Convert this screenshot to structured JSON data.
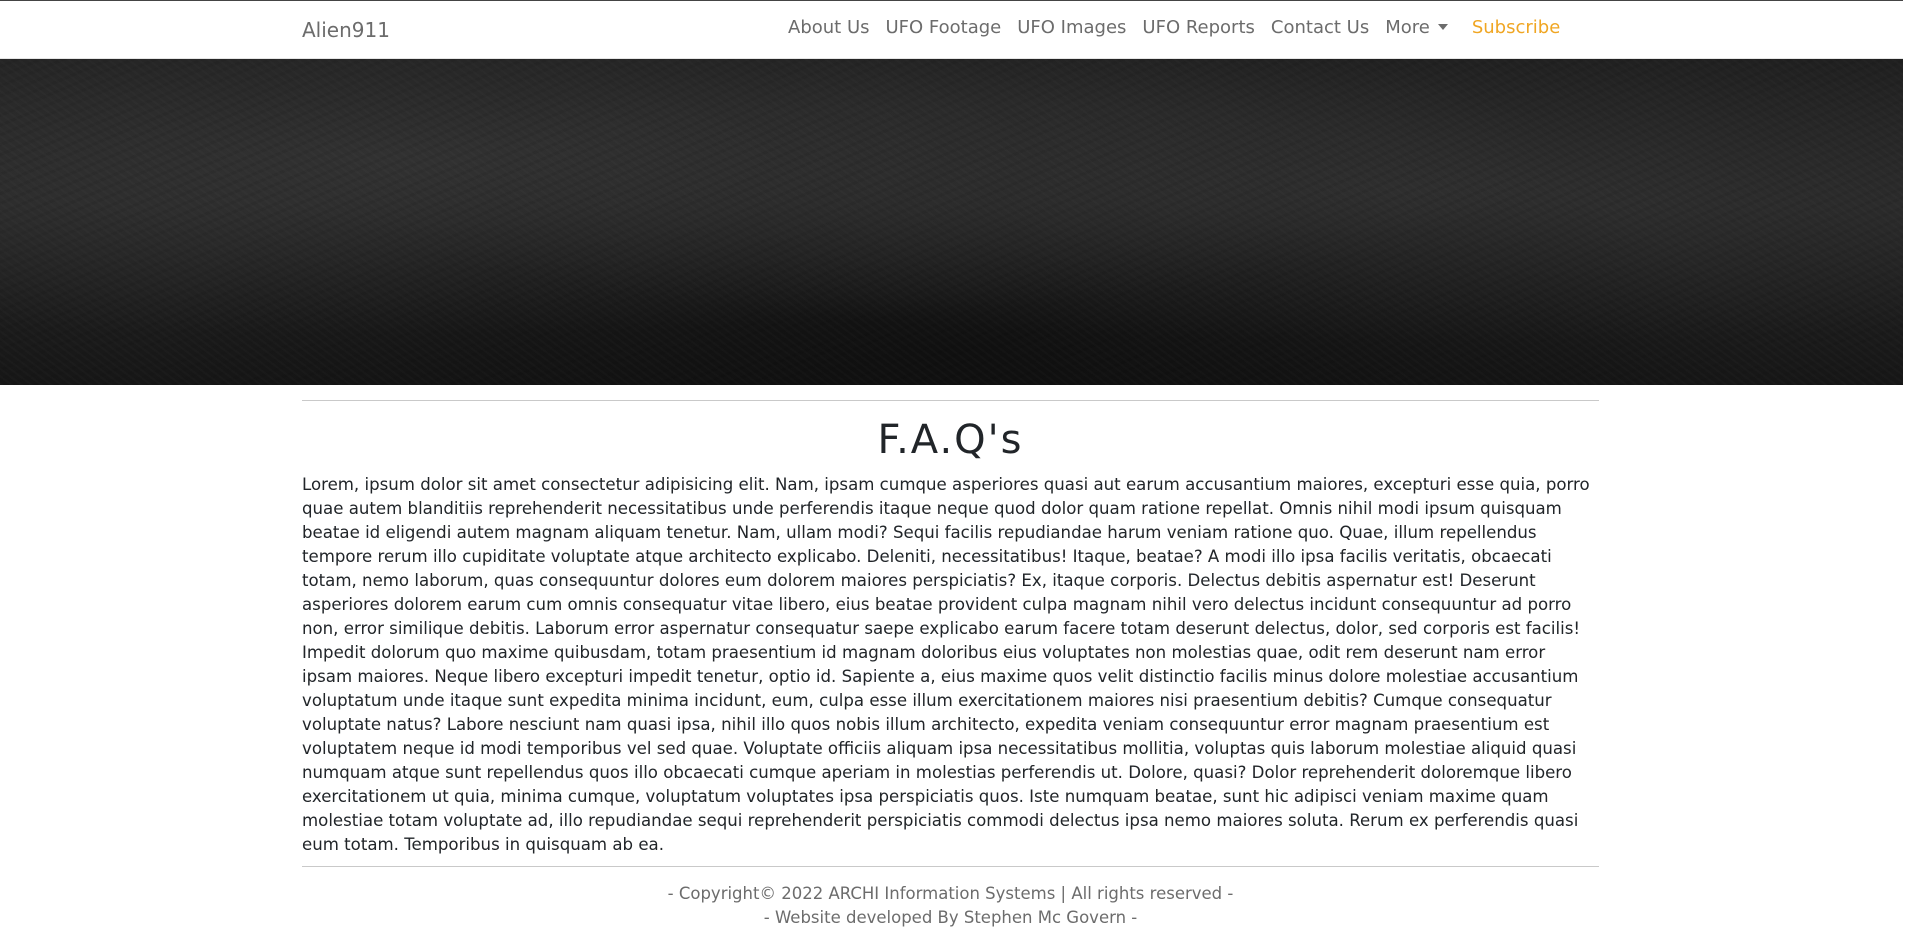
{
  "navbar": {
    "brand": "Alien911",
    "links": [
      {
        "label": "About Us"
      },
      {
        "label": "UFO Footage"
      },
      {
        "label": "UFO Images"
      },
      {
        "label": "UFO Reports"
      },
      {
        "label": "Contact Us"
      },
      {
        "label": "More"
      }
    ],
    "subscribe_label": "Subscribe",
    "subscribe_color": "#f0a623"
  },
  "main": {
    "title": "F.A.Q's",
    "body": "Lorem, ipsum dolor sit amet consectetur adipisicing elit. Nam, ipsam cumque asperiores quasi aut earum accusantium maiores, excepturi esse quia, porro quae autem blanditiis reprehenderit necessitatibus unde perferendis itaque neque quod dolor quam ratione repellat. Omnis nihil modi ipsum quisquam beatae id eligendi autem magnam aliquam tenetur. Nam, ullam modi? Sequi facilis repudiandae harum veniam ratione quo. Quae, illum repellendus tempore rerum illo cupiditate voluptate atque architecto explicabo. Deleniti, necessitatibus! Itaque, beatae? A modi illo ipsa facilis veritatis, obcaecati totam, nemo laborum, quas consequuntur dolores eum dolorem maiores perspiciatis? Ex, itaque corporis. Delectus debitis aspernatur est! Deserunt asperiores dolorem earum cum omnis consequatur vitae libero, eius beatae provident culpa magnam nihil vero delectus incidunt consequuntur ad porro non, error similique debitis. Laborum error aspernatur consequatur saepe explicabo earum facere totam deserunt delectus, dolor, sed corporis est facilis! Impedit dolorum quo maxime quibusdam, totam praesentium id magnam doloribus eius voluptates non molestias quae, odit rem deserunt nam error ipsam maiores. Neque libero excepturi impedit tenetur, optio id. Sapiente a, eius maxime quos velit distinctio facilis minus dolore molestiae accusantium voluptatum unde itaque sunt expedita minima incidunt, eum, culpa esse illum exercitationem maiores nisi praesentium debitis? Cumque consequatur voluptate natus? Labore nesciunt nam quasi ipsa, nihil illo quos nobis illum architecto, expedita veniam consequuntur error magnam praesentium est voluptatem neque id modi temporibus vel sed quae. Voluptate officiis aliquam ipsa necessitatibus mollitia, voluptas quis laborum molestiae aliquid quasi numquam atque sunt repellendus quos illo obcaecati cumque aperiam in molestias perferendis ut. Dolore, quasi? Dolor reprehenderit doloremque libero exercitationem ut quia, minima cumque, voluptatum voluptates ipsa perspiciatis quos. Iste numquam beatae, sunt hic adipisci veniam maxime quam molestiae totam voluptate ad, illo repudiandae sequi reprehenderit perspiciatis commodi delectus ipsa nemo maiores soluta. Rerum ex perferendis quasi eum totam. Temporibus in quisquam ab ea."
  },
  "footer": {
    "copyright": "- Copyright© 2022 ARCHI Information Systems | All rights reserved -",
    "developer": "- Website developed By Stephen Mc Govern -"
  }
}
